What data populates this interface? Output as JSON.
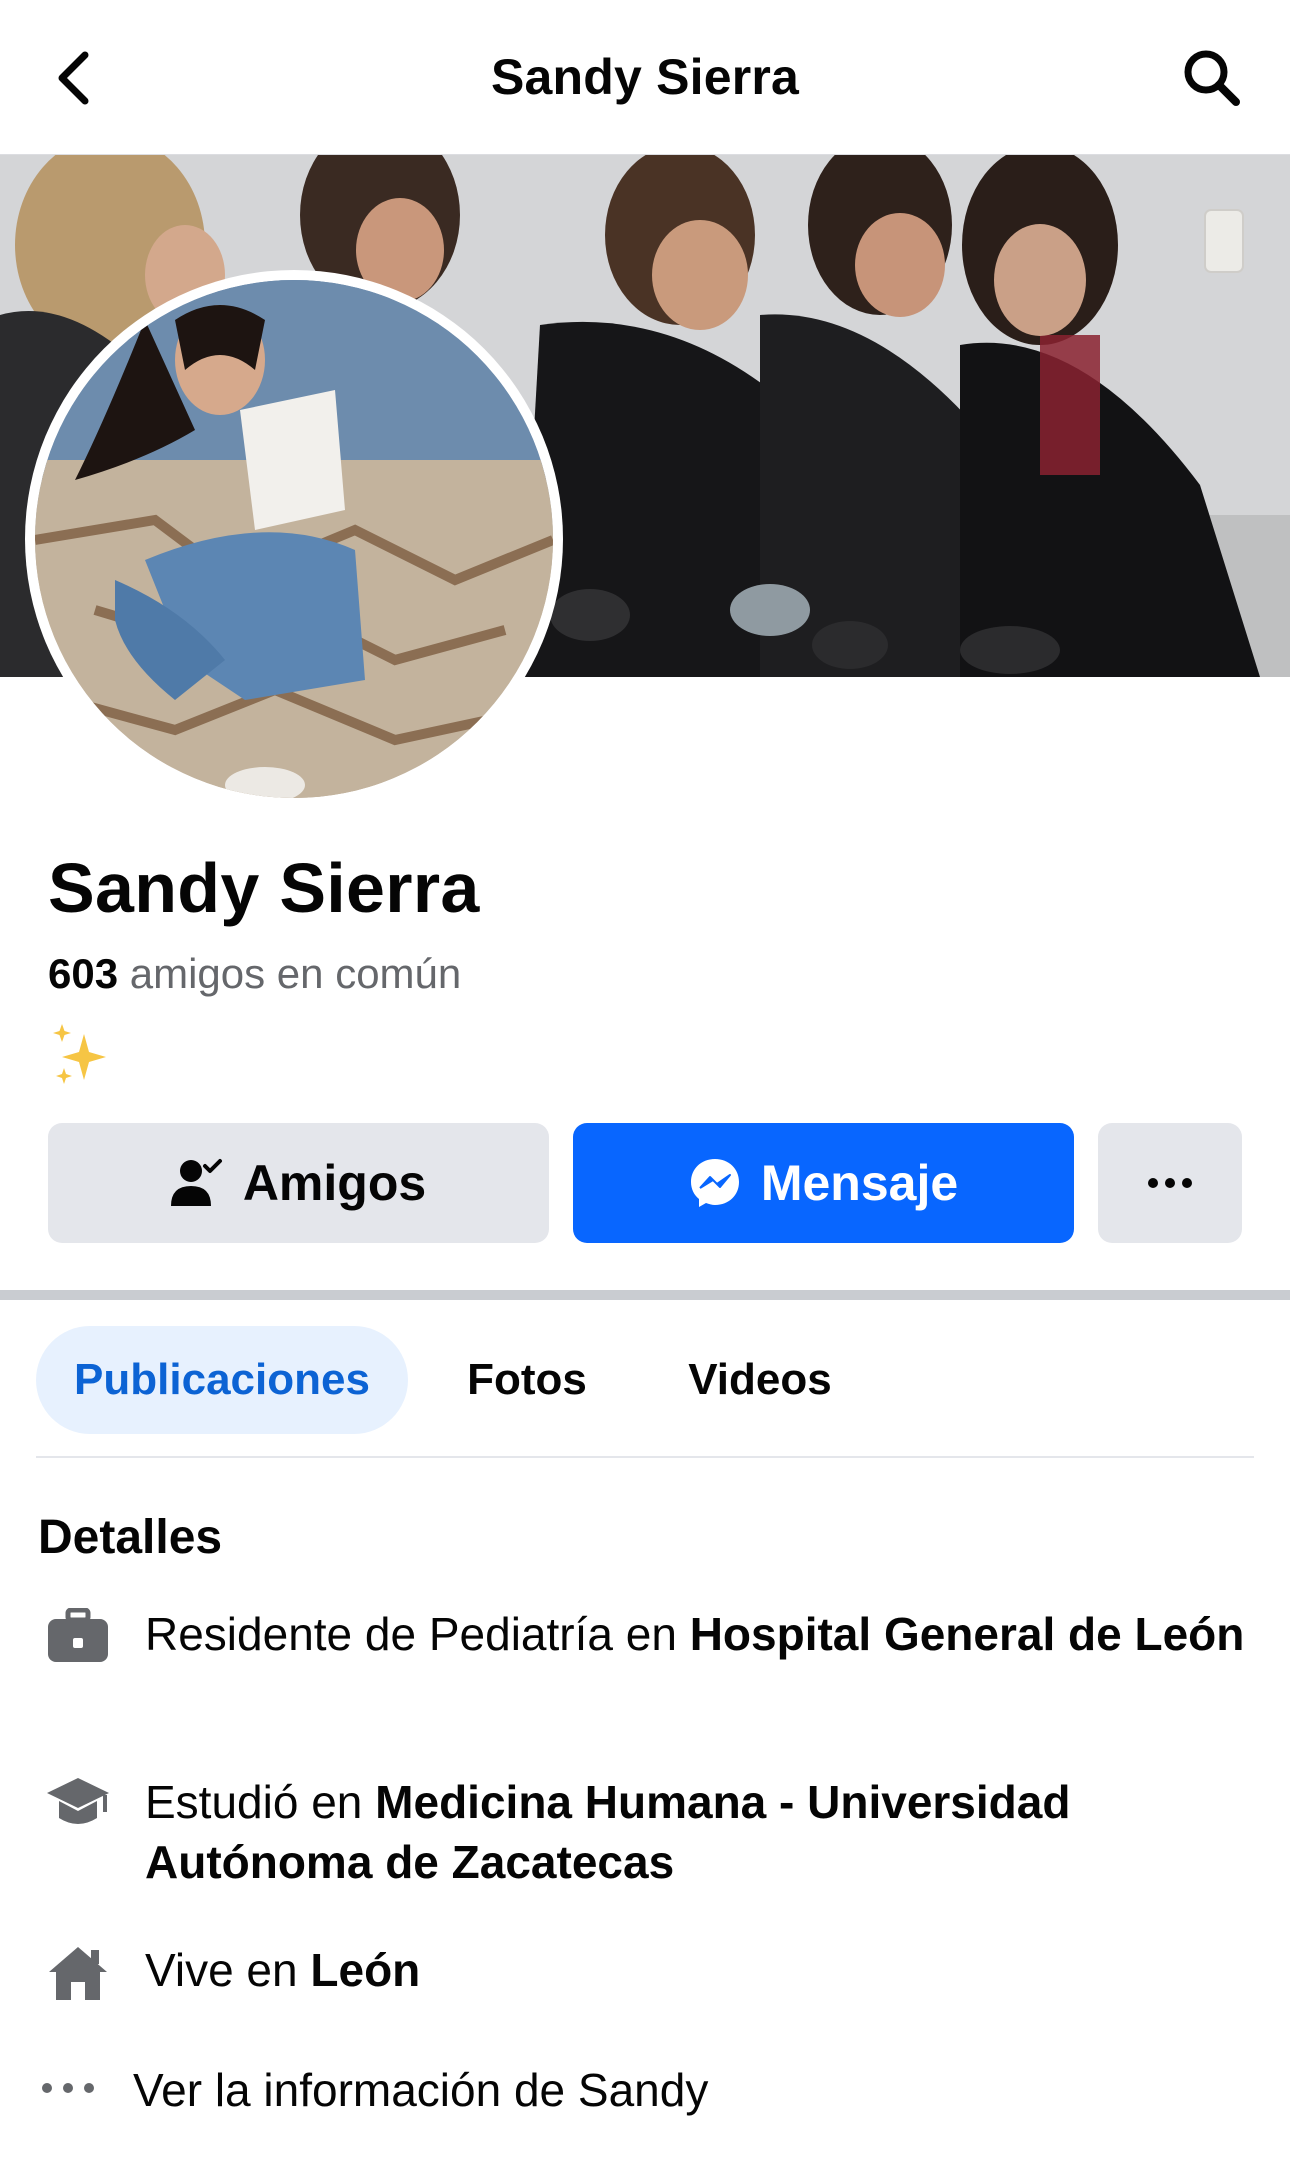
{
  "nav": {
    "title": "Sandy Sierra"
  },
  "profile": {
    "name": "Sandy Sierra",
    "mutual_count": "603",
    "mutual_label": "amigos en común",
    "bio_emoji_icon": "sparkles-icon"
  },
  "actions": {
    "friends_label": "Amigos",
    "message_label": "Mensaje",
    "more_icon": "more-dots-icon"
  },
  "tabs": [
    {
      "label": "Publicaciones",
      "active": true
    },
    {
      "label": "Fotos",
      "active": false
    },
    {
      "label": "Videos",
      "active": false
    }
  ],
  "details": {
    "title": "Detalles",
    "work": {
      "prefix": "Residente de Pediatría en ",
      "place": "Hospital General de León",
      "icon": "briefcase-icon"
    },
    "education": {
      "prefix": "Estudió en ",
      "place": "Medicina Humana - Universidad Autónoma de Zacatecas",
      "icon": "graduation-cap-icon"
    },
    "home": {
      "prefix": "Vive en ",
      "place": "León",
      "icon": "home-icon"
    },
    "more": {
      "label": "Ver la información de Sandy",
      "icon": "more-dots-icon"
    }
  },
  "colors": {
    "accent": "#0866ff",
    "tab_active_bg": "#e7f1fe",
    "tab_active_text": "#0c63d4",
    "button_gray": "#e4e6eb",
    "secondary_text": "#65676b"
  }
}
